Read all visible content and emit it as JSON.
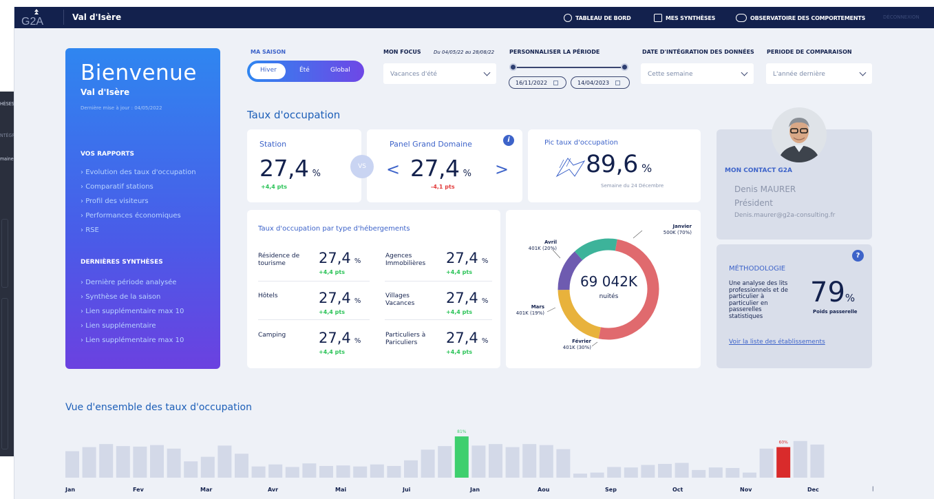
{
  "background_sidebar": {
    "items": [
      "HÈSES",
      "NTÉGRA",
      "maine"
    ]
  },
  "topbar": {
    "logo_text": "G2A",
    "site_name": "Val d'Isère",
    "nav": [
      {
        "label": "TABLEAU DE BORD",
        "icon": "dashboard-icon"
      },
      {
        "label": "MES SYNTHÈSES",
        "icon": "document-icon"
      },
      {
        "label": "OBSERVATOIRE DES COMPORTEMENTS",
        "icon": "binoculars-icon"
      }
    ],
    "logout": "DÉCONNEXION"
  },
  "welcome": {
    "title": "Bienvenue",
    "location": "Val d'Isère",
    "updated": "Dernière mise à jour : 04/05/2022",
    "reports_title": "VOS RAPPORTS",
    "reports": [
      "Evolution des taux d'occupation",
      "Comparatif stations",
      "Profil des visiteurs",
      "Performances économiques",
      "RSE"
    ],
    "syntheses_title": "DERNIÈRES SYNTHÈSES",
    "syntheses": [
      "Dernière période analysée",
      "Synthèse de la saison",
      "Lien supplémentaire max 10",
      "Lien supplémentaire",
      "Lien supplémentaire max 10"
    ]
  },
  "filters": {
    "season_label": "MA SAISON",
    "season_options": [
      "Hiver",
      "Été",
      "Global"
    ],
    "season_selected": "Hiver",
    "focus_label": "MON FOCUS",
    "focus_range": "Du 04/05/22 au 28/08/22",
    "focus_value": "Vacances d'été",
    "period_label": "PERSONNALISER LA PÉRIODE",
    "period_start": "16/11/2022",
    "period_end": "14/04/2023",
    "integration_label": "DATE D'INTÉGRATION DES DONNÉES",
    "integration_value": "Cette semaine",
    "comparison_label": "PERIODE DE COMPARAISON",
    "comparison_value": "L'année dernière"
  },
  "occupation": {
    "title": "Taux d'occupation",
    "station": {
      "label": "Station",
      "value": "27,4",
      "unit": "%",
      "delta": "+4,4 pts"
    },
    "vs": "VS",
    "panel": {
      "label": "Panel Grand Domaine",
      "value": "27,4",
      "unit": "%",
      "delta": "-4,1 pts",
      "prev": "<",
      "next": ">"
    },
    "peak": {
      "label": "Pic taux d'occupation",
      "value": "89,6",
      "unit": "%",
      "sub": "Semaine du 24 Décembre"
    }
  },
  "by_type": {
    "title": "Taux d'occupation par type d'hébergements",
    "items": [
      {
        "name": "Résidence de tourisme",
        "value": "27,4",
        "unit": "%",
        "delta": "+4,4 pts"
      },
      {
        "name": "Agences Immobilières",
        "value": "27,4",
        "unit": "%",
        "delta": "+4,4 pts"
      },
      {
        "name": "Hôtels",
        "value": "27,4",
        "unit": "%",
        "delta": "+4,4 pts"
      },
      {
        "name": "Villages Vacances",
        "value": "27,4",
        "unit": "%",
        "delta": "+4,4 pts"
      },
      {
        "name": "Camping",
        "value": "27,4",
        "unit": "%",
        "delta": "+4,4 pts"
      },
      {
        "name": "Particuliers à Pariculiers",
        "value": "27,4",
        "unit": "%",
        "delta": "+4,4 pts"
      }
    ]
  },
  "donut": {
    "center_value": "69 042K",
    "center_label": "nuités",
    "segments": [
      {
        "name": "Janvier",
        "label": "500K (70%)",
        "share": 0.7,
        "color": "#e06a6e"
      },
      {
        "name": "Février",
        "label": "401K (30%)",
        "share": 0.3,
        "color": "#e8b23c"
      },
      {
        "name": "Mars",
        "label": "401K (19%)",
        "share": 0.19,
        "color": "#6e5bb0"
      },
      {
        "name": "Avril",
        "label": "401K (20%)",
        "share": 0.2,
        "color": "#3db39a"
      }
    ]
  },
  "contact": {
    "title": "MON CONTACT G2A",
    "name": "Denis MAURER",
    "role": "Président",
    "email": "Denis.maurer@g2a-consulting.fr"
  },
  "methodology": {
    "title": "MÉTHODOLOGIE",
    "help": "?",
    "text": "Une analyse des lits professionnels et de particulier à particulier en passerelles statistiques",
    "value": "79",
    "unit": "%",
    "value_label": "Poids passerelle",
    "link": "Voir la liste des établissements"
  },
  "chart_data": {
    "type": "bar",
    "title": "Vue d'ensemble des taux d'occupation",
    "month_labels": [
      "Jan",
      "Fev",
      "Mar",
      "Avr",
      "Mai",
      "Jui",
      "Jan",
      "Aou",
      "Sep",
      "Oct",
      "Nov",
      "Dec"
    ],
    "values": [
      52,
      60,
      66,
      62,
      61,
      64,
      57,
      32,
      41,
      63,
      47,
      22,
      26,
      21,
      28,
      23,
      24,
      22,
      26,
      23,
      34,
      55,
      62,
      81,
      63,
      66,
      60,
      66,
      64,
      56,
      8,
      10,
      21,
      20,
      25,
      27,
      29,
      15,
      20,
      19,
      10,
      57,
      60,
      72,
      65
    ],
    "highlights": [
      {
        "index": 23,
        "label": "81%",
        "color": "#3ecf6e"
      },
      {
        "index": 42,
        "label": "60%",
        "color": "#d92b2b"
      }
    ],
    "bar_color": "#d3d9e8",
    "ylim": [
      0,
      100
    ]
  }
}
